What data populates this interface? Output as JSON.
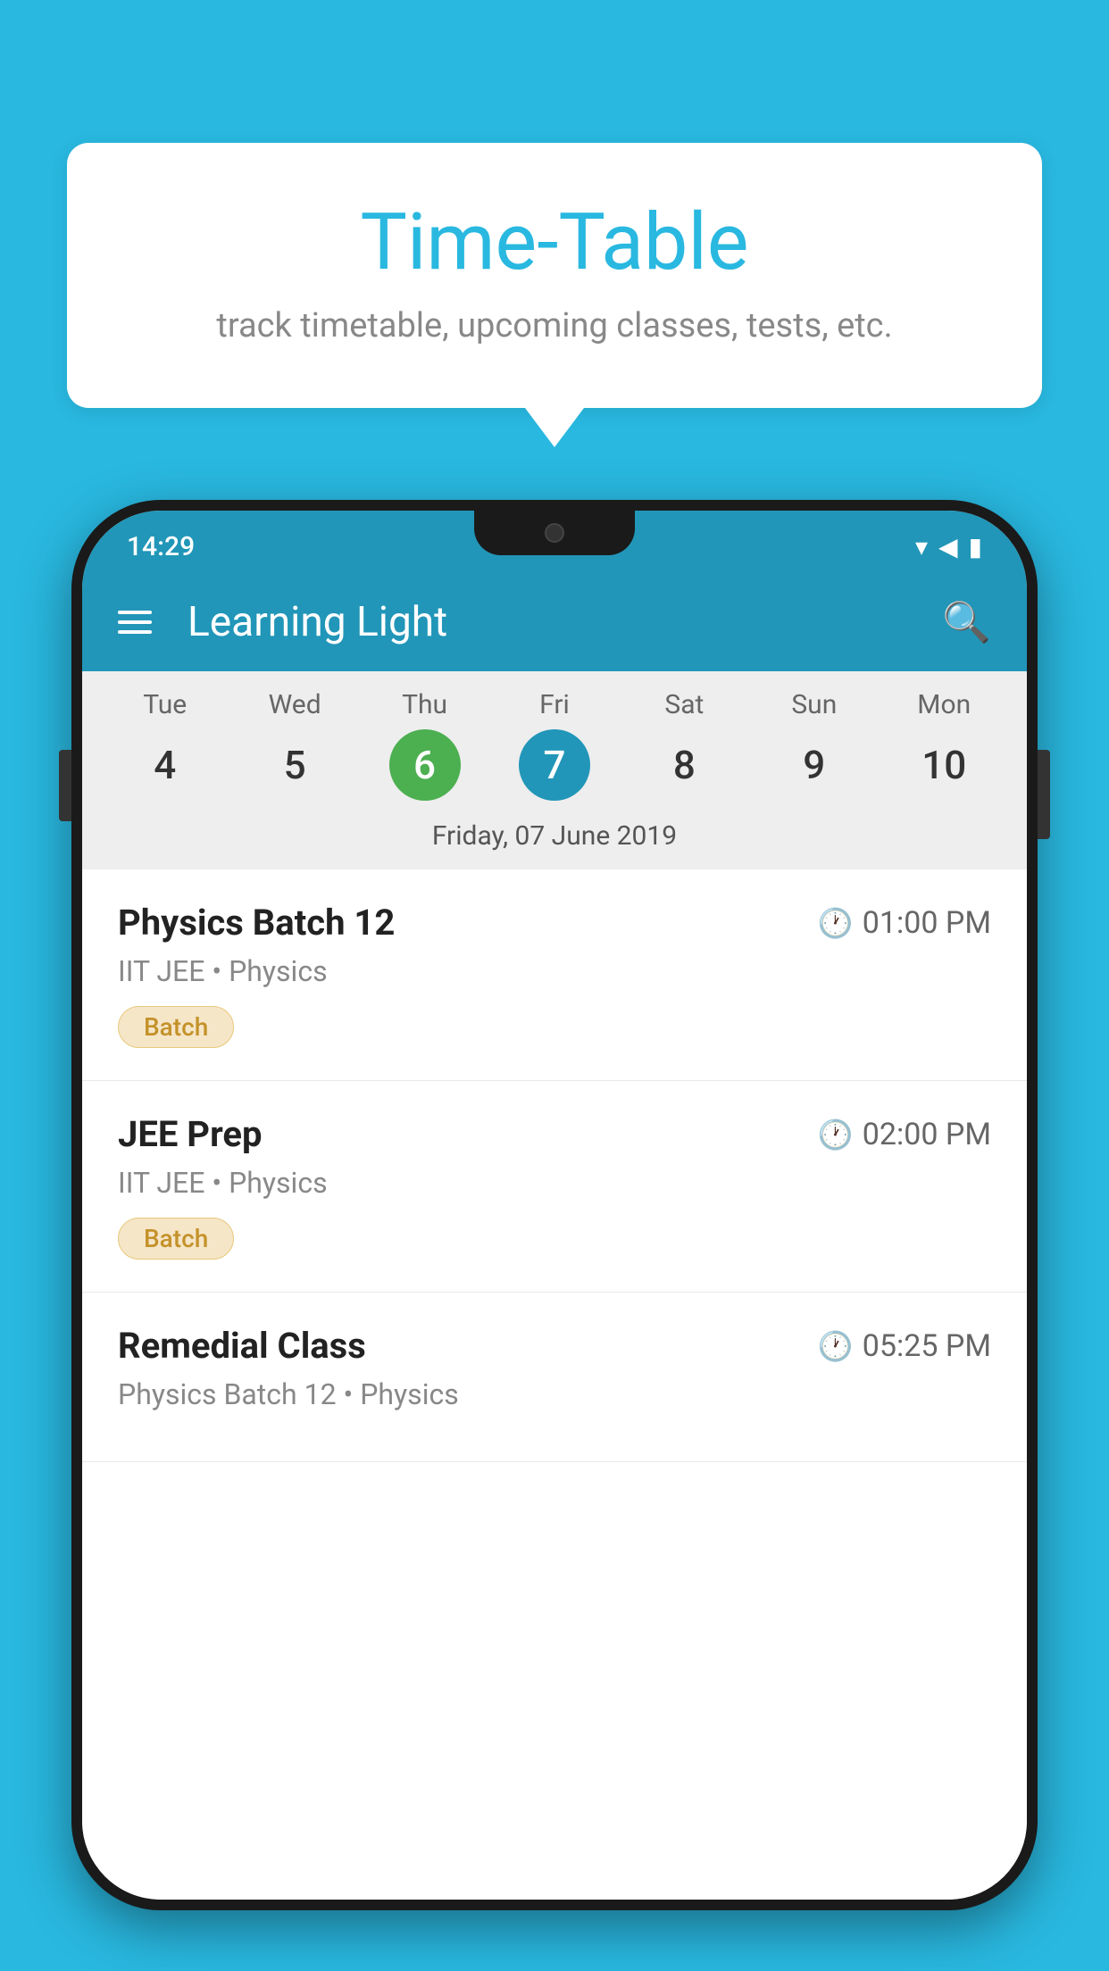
{
  "background_color": "#29b8e0",
  "speech_bubble": {
    "title": "Time-Table",
    "subtitle": "track timetable, upcoming classes, tests, etc."
  },
  "phone": {
    "status_bar": {
      "time": "14:29"
    },
    "app_bar": {
      "title": "Learning Light"
    },
    "calendar": {
      "days": [
        {
          "name": "Tue",
          "num": "4",
          "state": "normal"
        },
        {
          "name": "Wed",
          "num": "5",
          "state": "normal"
        },
        {
          "name": "Thu",
          "num": "6",
          "state": "today"
        },
        {
          "name": "Fri",
          "num": "7",
          "state": "selected"
        },
        {
          "name": "Sat",
          "num": "8",
          "state": "normal"
        },
        {
          "name": "Sun",
          "num": "9",
          "state": "normal"
        },
        {
          "name": "Mon",
          "num": "10",
          "state": "normal"
        }
      ],
      "selected_date_label": "Friday, 07 June 2019"
    },
    "schedule_items": [
      {
        "name": "Physics Batch 12",
        "time": "01:00 PM",
        "sub": "IIT JEE • Physics",
        "badge": "Batch"
      },
      {
        "name": "JEE Prep",
        "time": "02:00 PM",
        "sub": "IIT JEE • Physics",
        "badge": "Batch"
      },
      {
        "name": "Remedial Class",
        "time": "05:25 PM",
        "sub": "Physics Batch 12 • Physics",
        "badge": null
      }
    ]
  }
}
